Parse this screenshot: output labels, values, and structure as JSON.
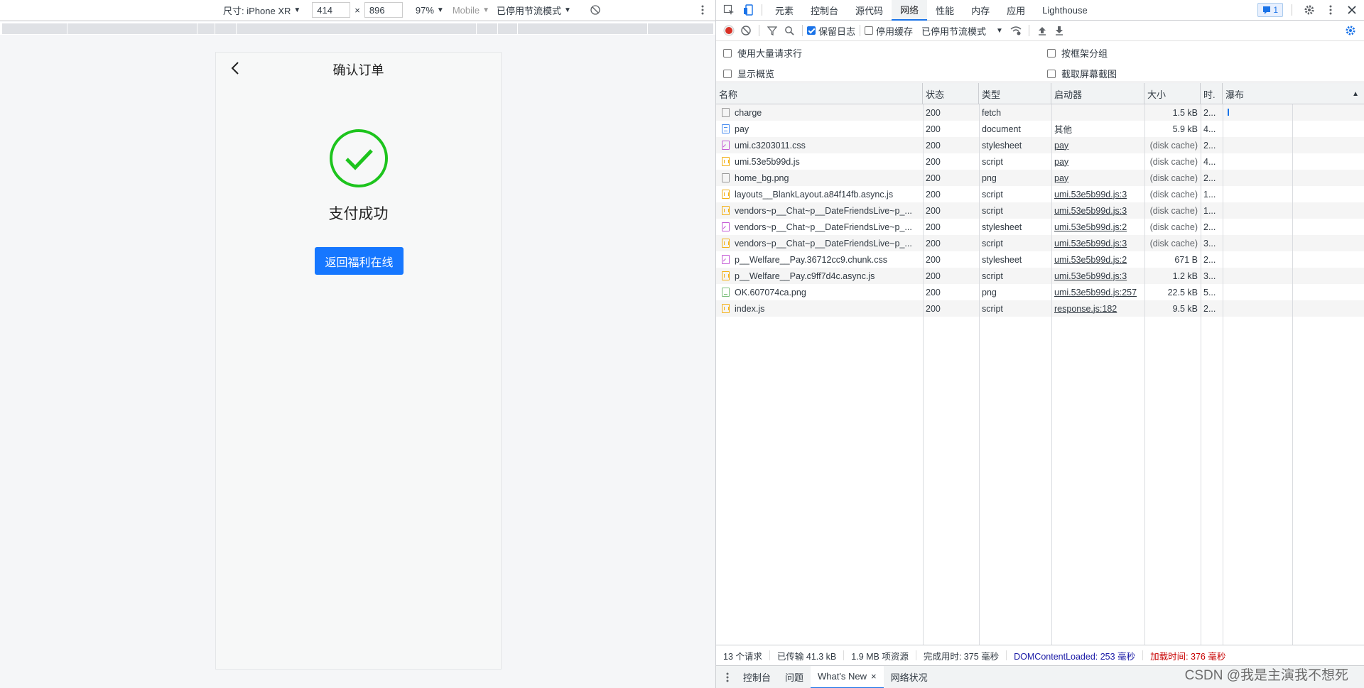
{
  "device_toolbar": {
    "dimensions_label": "尺寸: iPhone XR",
    "width": "414",
    "times": "×",
    "height": "896",
    "zoom": "97%",
    "device_type": "Mobile",
    "throttle": "已停用节流模式"
  },
  "phone": {
    "title": "确认订单",
    "success_text": "支付成功",
    "return_button": "返回福利在线",
    "success_color": "#1dc41d",
    "button_color": "#1677ff"
  },
  "devtools": {
    "tabs": [
      "元素",
      "控制台",
      "源代码",
      "网络",
      "性能",
      "内存",
      "应用",
      "Lighthouse"
    ],
    "active_tab": "网络",
    "issues_count": "1",
    "toolbar": {
      "preserve_log": "保留日志",
      "disable_cache": "停用缓存",
      "throttle": "已停用节流模式"
    },
    "options": {
      "large_rows": "使用大量请求行",
      "group_by_frame": "按框架分组",
      "show_overview": "显示概览",
      "capture_screenshots": "截取屏幕截图"
    },
    "columns": [
      "名称",
      "状态",
      "类型",
      "启动器",
      "大小",
      "时.",
      "瀑布"
    ],
    "requests": [
      {
        "name": "charge",
        "icon": "fetch",
        "status": "200",
        "type": "fetch",
        "initiator": "",
        "size": "1.5 kB",
        "time": "2..."
      },
      {
        "name": "pay",
        "icon": "doc",
        "status": "200",
        "type": "document",
        "initiator": "其他",
        "size": "5.9 kB",
        "time": "4..."
      },
      {
        "name": "umi.c3203011.css",
        "icon": "css",
        "status": "200",
        "type": "stylesheet",
        "initiator": "pay",
        "size": "(disk cache)",
        "time": "2..."
      },
      {
        "name": "umi.53e5b99d.js",
        "icon": "js",
        "status": "200",
        "type": "script",
        "initiator": "pay",
        "size": "(disk cache)",
        "time": "4..."
      },
      {
        "name": "home_bg.png",
        "icon": "fetch",
        "status": "200",
        "type": "png",
        "initiator": "pay",
        "size": "(disk cache)",
        "time": "2..."
      },
      {
        "name": "layouts__BlankLayout.a84f14fb.async.js",
        "icon": "js",
        "status": "200",
        "type": "script",
        "initiator": "umi.53e5b99d.js:3",
        "size": "(disk cache)",
        "time": "1..."
      },
      {
        "name": "vendors~p__Chat~p__DateFriendsLive~p_...",
        "icon": "js",
        "status": "200",
        "type": "script",
        "initiator": "umi.53e5b99d.js:3",
        "size": "(disk cache)",
        "time": "1..."
      },
      {
        "name": "vendors~p__Chat~p__DateFriendsLive~p_...",
        "icon": "css",
        "status": "200",
        "type": "stylesheet",
        "initiator": "umi.53e5b99d.js:2",
        "size": "(disk cache)",
        "time": "2..."
      },
      {
        "name": "vendors~p__Chat~p__DateFriendsLive~p_...",
        "icon": "js",
        "status": "200",
        "type": "script",
        "initiator": "umi.53e5b99d.js:3",
        "size": "(disk cache)",
        "time": "3..."
      },
      {
        "name": "p__Welfare__Pay.36712cc9.chunk.css",
        "icon": "css",
        "status": "200",
        "type": "stylesheet",
        "initiator": "umi.53e5b99d.js:2",
        "size": "671 B",
        "time": "2..."
      },
      {
        "name": "p__Welfare__Pay.c9ff7d4c.async.js",
        "icon": "js",
        "status": "200",
        "type": "script",
        "initiator": "umi.53e5b99d.js:3",
        "size": "1.2 kB",
        "time": "3..."
      },
      {
        "name": "OK.607074ca.png",
        "icon": "img",
        "status": "200",
        "type": "png",
        "initiator": "umi.53e5b99d.js:257",
        "size": "22.5 kB",
        "time": "5..."
      },
      {
        "name": "index.js",
        "icon": "js",
        "status": "200",
        "type": "script",
        "initiator": "response.js:182",
        "size": "9.5 kB",
        "time": "2..."
      }
    ],
    "status_bar": {
      "requests": "13 个请求",
      "transferred": "已传输 41.3 kB",
      "resources": "1.9 MB 项资源",
      "finish": "完成用时: 375 毫秒",
      "dom_loaded": "DOMContentLoaded: 253 毫秒",
      "load": "加载时间: 376 毫秒",
      "dom_color": "#1a1aa6",
      "load_color": "#c80000"
    },
    "drawer_tabs": [
      "控制台",
      "问题",
      "What's New",
      "网络状况"
    ],
    "drawer_active": "What's New"
  },
  "watermark": "CSDN @我是主演我不想死"
}
